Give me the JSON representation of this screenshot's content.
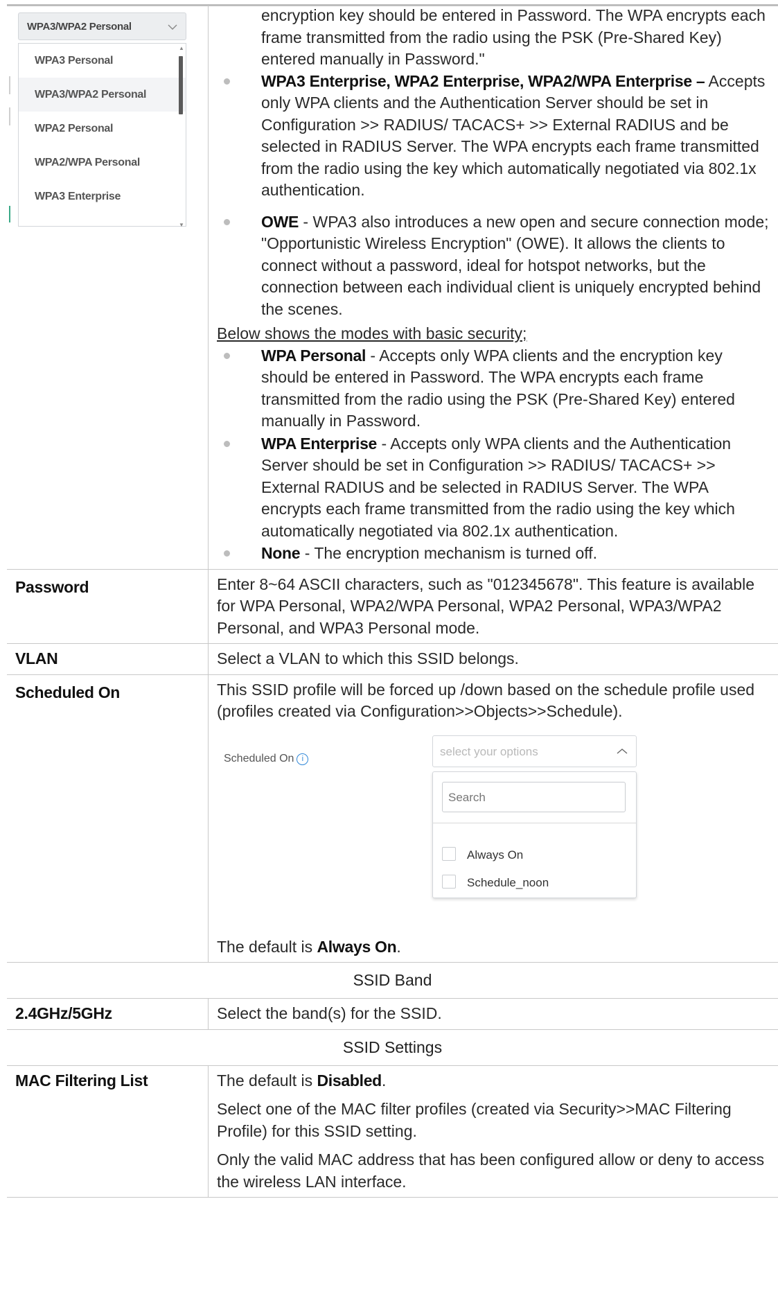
{
  "dropdown": {
    "selected": "WPA3/WPA2 Personal",
    "options": [
      "WPA3 Personal",
      "WPA3/WPA2 Personal",
      "WPA2 Personal",
      "WPA2/WPA Personal",
      "WPA3 Enterprise"
    ]
  },
  "security_intro": "encryption key should be entered in Password. The WPA encrypts each frame transmitted from the radio using the PSK (Pre-Shared Key) entered manually in Password.\"",
  "bullets": [
    {
      "term": "WPA3 Enterprise, WPA2 Enterprise, WPA2/WPA Enterprise –",
      "text": " Accepts only WPA clients and the Authentication Server should be set in Configuration >> RADIUS/ TACACS+ >> External RADIUS and be selected in RADIUS Server. The WPA encrypts each frame transmitted from the radio using the key which automatically negotiated via 802.1x authentication."
    },
    {
      "term": "OWE",
      "text": " - WPA3 also introduces a new open and secure connection mode; \"Opportunistic Wireless Encryption\" (OWE). It allows the clients to connect without a password, ideal for hotspot networks, but the connection between each individual client is uniquely encrypted behind the scenes."
    }
  ],
  "basic_heading": "Below shows the modes with basic security;",
  "basic_bullets": [
    {
      "term": "WPA Personal",
      "text": " - Accepts only WPA clients and the encryption key should be entered in Password. The WPA encrypts each frame transmitted from the radio using the PSK (Pre-Shared Key) entered manually in Password."
    },
    {
      "term": "WPA Enterprise",
      "text": " - Accepts only WPA clients and the Authentication Server should be set in Configuration >> RADIUS/ TACACS+ >> External RADIUS and be selected in RADIUS Server. The WPA encrypts each frame transmitted from the radio using the key which automatically negotiated via 802.1x authentication."
    },
    {
      "term": "None",
      "text": " - The encryption mechanism is turned off."
    }
  ],
  "rows": {
    "password": {
      "label": "Password",
      "desc": "Enter 8~64 ASCII characters, such as \"012345678\". This feature is available for WPA Personal, WPA2/WPA Personal, WPA2 Personal, WPA3/WPA2 Personal, and WPA3 Personal mode."
    },
    "vlan": {
      "label": "VLAN",
      "desc": "Select a VLAN to which this SSID belongs."
    },
    "scheduled": {
      "label": "Scheduled On",
      "desc": "This SSID profile will be forced up /down based on the schedule profile used (profiles created via Configuration>>Objects>>Schedule).",
      "widget_label": "Scheduled On",
      "info_icon": "i",
      "placeholder": "select your options",
      "search_placeholder": "Search",
      "options": [
        "Always On",
        "Schedule_noon"
      ],
      "default_prefix": "The default is ",
      "default_value": "Always On",
      "default_suffix": "."
    },
    "band_section": "SSID Band",
    "band": {
      "label": "2.4GHz/5GHz",
      "desc": "Select the band(s) for the SSID."
    },
    "settings_section": "SSID Settings",
    "mac": {
      "label": "MAC Filtering List",
      "default_prefix": "The default is ",
      "default_value": "Disabled",
      "default_suffix": ".",
      "p2": "Select one of the MAC filter profiles (created via Security>>MAC Filtering Profile) for this SSID setting.",
      "p3": "Only the valid MAC address that has been configured allow or deny to access the wireless LAN interface."
    }
  }
}
